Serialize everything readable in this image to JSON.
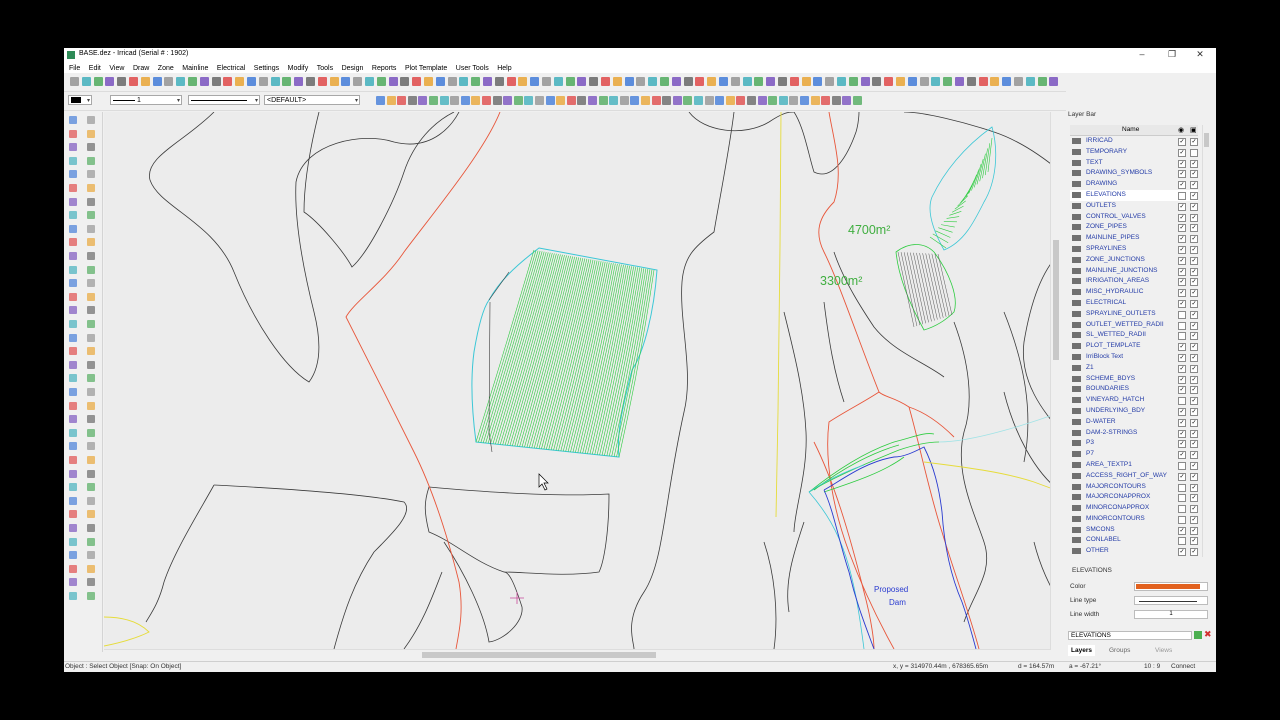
{
  "window": {
    "title": "BASE.dez - Irricad (Serial # : 1902)",
    "minimize": "–",
    "maximize": "❐",
    "close": "✕"
  },
  "menu": [
    "File",
    "Edit",
    "View",
    "Draw",
    "Zone",
    "Mainline",
    "Electrical",
    "Settings",
    "Modify",
    "Tools",
    "Design",
    "Reports",
    "Plot Template",
    "User Tools",
    "Help"
  ],
  "toolbar2": {
    "color_combo": "",
    "linewidth_combo": "1",
    "linetype_combo": "",
    "style_combo": "<DEFAULT>"
  },
  "canvas": {
    "area_labels": [
      "4700m²",
      "3300m²"
    ],
    "proposed_dam_label": [
      "Proposed",
      "Dam"
    ]
  },
  "layer_bar": {
    "title": "Layer Bar",
    "column_name": "Name",
    "layers": [
      {
        "name": "IRRICAD",
        "visible": true,
        "locked": true
      },
      {
        "name": "TEMPORARY",
        "visible": true,
        "locked": false
      },
      {
        "name": "TEXT",
        "visible": true,
        "locked": true
      },
      {
        "name": "DRAWING_SYMBOLS",
        "visible": true,
        "locked": true
      },
      {
        "name": "DRAWING",
        "visible": true,
        "locked": true
      },
      {
        "name": "ELEVATIONS",
        "visible": false,
        "locked": true,
        "selected": true
      },
      {
        "name": "OUTLETS",
        "visible": true,
        "locked": true
      },
      {
        "name": "CONTROL_VALVES",
        "visible": true,
        "locked": true
      },
      {
        "name": "ZONE_PIPES",
        "visible": true,
        "locked": true
      },
      {
        "name": "MAINLINE_PIPES",
        "visible": true,
        "locked": true
      },
      {
        "name": "SPRAYLINES",
        "visible": true,
        "locked": true
      },
      {
        "name": "ZONE_JUNCTIONS",
        "visible": true,
        "locked": true
      },
      {
        "name": "MAINLINE_JUNCTIONS",
        "visible": true,
        "locked": true
      },
      {
        "name": "IRRIGATION_AREAS",
        "visible": true,
        "locked": true
      },
      {
        "name": "MISC_HYDRAULIC",
        "visible": true,
        "locked": true
      },
      {
        "name": "ELECTRICAL",
        "visible": true,
        "locked": true
      },
      {
        "name": "SPRAYLINE_OUTLETS",
        "visible": false,
        "locked": true
      },
      {
        "name": "OUTLET_WETTED_RADII",
        "visible": false,
        "locked": true
      },
      {
        "name": "SL_WETTED_RADII",
        "visible": false,
        "locked": true
      },
      {
        "name": "PLOT_TEMPLATE",
        "visible": true,
        "locked": true
      },
      {
        "name": "IrriBlock Text",
        "visible": true,
        "locked": true
      },
      {
        "name": "Z1",
        "visible": true,
        "locked": true
      },
      {
        "name": "SCHEME_BDYS",
        "visible": true,
        "locked": true
      },
      {
        "name": "BOUNDARIES",
        "visible": true,
        "locked": true
      },
      {
        "name": "VINEYARD_HATCH",
        "visible": false,
        "locked": true
      },
      {
        "name": "UNDERLYING_BDY",
        "visible": true,
        "locked": true
      },
      {
        "name": "D-WATER",
        "visible": true,
        "locked": true
      },
      {
        "name": "DAM-2-STRINGS",
        "visible": true,
        "locked": true
      },
      {
        "name": "P3",
        "visible": true,
        "locked": true
      },
      {
        "name": "P7",
        "visible": true,
        "locked": true
      },
      {
        "name": "AREA_TEXTP1",
        "visible": false,
        "locked": true
      },
      {
        "name": "ACCESS_RIGHT_OF_WAY",
        "visible": true,
        "locked": true
      },
      {
        "name": "MAJORCONTOURS",
        "visible": false,
        "locked": true
      },
      {
        "name": "MAJORCONAPPROX",
        "visible": false,
        "locked": true
      },
      {
        "name": "MINORCONAPPROX",
        "visible": false,
        "locked": true
      },
      {
        "name": "MINORCONTOURS",
        "visible": false,
        "locked": true
      },
      {
        "name": "SMCONS",
        "visible": true,
        "locked": true
      },
      {
        "name": "CONLABEL",
        "visible": false,
        "locked": true
      },
      {
        "name": "OTHER",
        "visible": true,
        "locked": true
      }
    ],
    "props": {
      "section_title": "ELEVATIONS",
      "color_label": "Color",
      "color_value": "#e2621f",
      "linetype_label": "Line type",
      "linewidth_label": "Line width",
      "linewidth_value": "1"
    },
    "search_value": "ELEVATIONS",
    "tabs": [
      "Layers",
      "Groups",
      "Views"
    ]
  },
  "status": {
    "mode": "Object : Select Object  [Snap: On Object]",
    "coords": "x, y = 314970.44m , 678365.65m",
    "distance": "d = 164.57m",
    "angle": "a = -67.21°",
    "cell": "10 : 9",
    "connect": "Connect"
  },
  "colors": {
    "accent_green": "#2ecc40",
    "cyan": "#3bc7d6",
    "boundary_red": "#e8563a",
    "label_green": "#3fae3f",
    "dam_blue": "#2a3bd0",
    "yellow": "#e6dc3a"
  }
}
